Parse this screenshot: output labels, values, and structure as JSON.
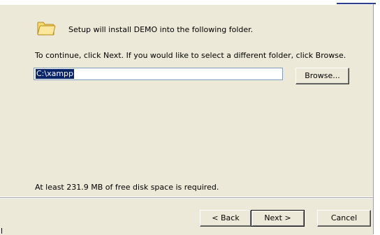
{
  "header": {
    "message": "Setup will install DEMO into the following folder.",
    "icon": "folder-icon"
  },
  "instructions": "To continue, click Next. If you would like to select a different folder, click Browse.",
  "destination": {
    "value": "C:\\xampp",
    "browse_label": "Browse..."
  },
  "disk_space": "At least 231.9 MB of free disk space is required.",
  "footer": {
    "back_label": "< Back",
    "next_label": "Next >",
    "cancel_label": "Cancel"
  },
  "colors": {
    "panel": "#ece9d8",
    "selection": "#0a246a",
    "folder_fill": "#f6d86b",
    "folder_stroke": "#b88a1e",
    "accent": "#2d3e8c"
  }
}
